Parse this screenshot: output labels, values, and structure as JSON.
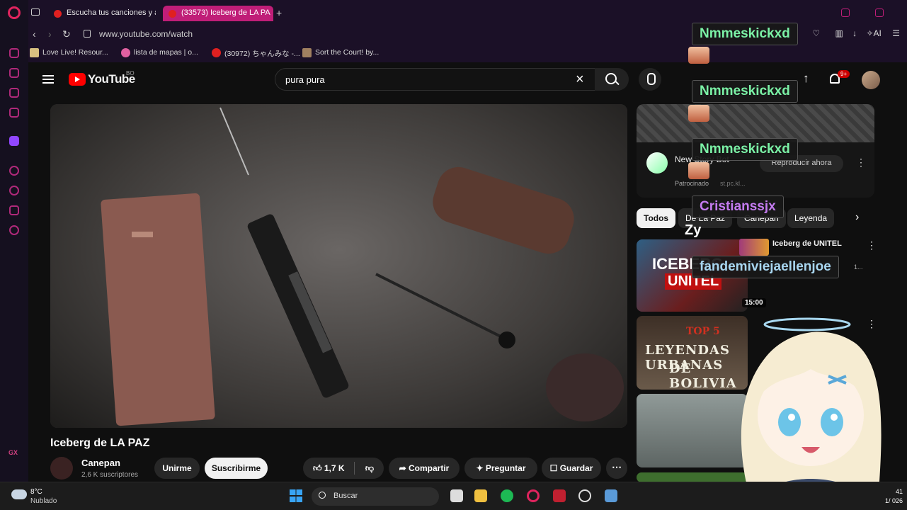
{
  "browser": {
    "tabs": [
      {
        "label": "Escucha tus canciones y a"
      },
      {
        "label": "(33573) Iceberg de LA PA"
      }
    ],
    "new_tab_symbol": "+",
    "url": "www.youtube.com/watch",
    "extension_ai_label": "AI",
    "bookmarks": [
      {
        "label": "Love Live! Resour..."
      },
      {
        "label": "lista de mapas | o..."
      },
      {
        "label": "(30972) ちゃんみな -..."
      },
      {
        "label": "Sort the Court! by..."
      }
    ],
    "sidebar_label": "GX"
  },
  "youtube": {
    "logo_text": "YouTube",
    "country_code": "BO",
    "search_query": "pura pura",
    "notification_count": "9+",
    "video": {
      "title": "Iceberg de LA PAZ",
      "channel_name": "Canepan",
      "subscribers": "2,6 K suscriptores",
      "join_label": "Unirme",
      "subscribe_label": "Suscribirme",
      "likes": "1,7 K",
      "share_label": "Compartir",
      "ask_label": "Preguntar",
      "save_label": "Guardar"
    },
    "ad": {
      "title": "New Story Bot",
      "sponsored": "Patrocinado",
      "url": "st.pc.kl...",
      "play_label": "Reproducir ahora"
    },
    "chips": [
      {
        "label": "Todos"
      },
      {
        "label": "De La Paz"
      },
      {
        "label": "Canepan"
      },
      {
        "label": "Leyenda"
      }
    ],
    "recommended": [
      {
        "title": "Iceberg de UNITEL",
        "thumb_text": "ICEBERG",
        "thumb_brand": "UNITEL",
        "duration": "15:00",
        "meta": "1..."
      },
      {
        "thumb_top": "TOP 5",
        "thumb_line1": "LEYENDAS URBANAS",
        "thumb_line2": "DE BOLIVIA"
      },
      {
        "title": ""
      }
    ]
  },
  "stream_overlay": {
    "chat": [
      {
        "user": "Nmmeskickxd",
        "color": "#7bf2a6"
      },
      {
        "user": "Nmmeskickxd",
        "color": "#7bf2a6"
      },
      {
        "user": "Nmmeskickxd",
        "color": "#7bf2a6"
      },
      {
        "user": "Cristianssjx",
        "color": "#c47bf0",
        "message": "Zy"
      },
      {
        "user": "fandemiviejaellenjoe",
        "color": "#a8d6f0"
      }
    ]
  },
  "taskbar": {
    "temperature": "8°C",
    "weather": "Nublado",
    "search_label": "Buscar",
    "time": "41",
    "date": "1/ 026"
  },
  "colors": {
    "accent": "#c01e78",
    "youtube_red": "#ff0000",
    "background": "#0f0f0f"
  }
}
